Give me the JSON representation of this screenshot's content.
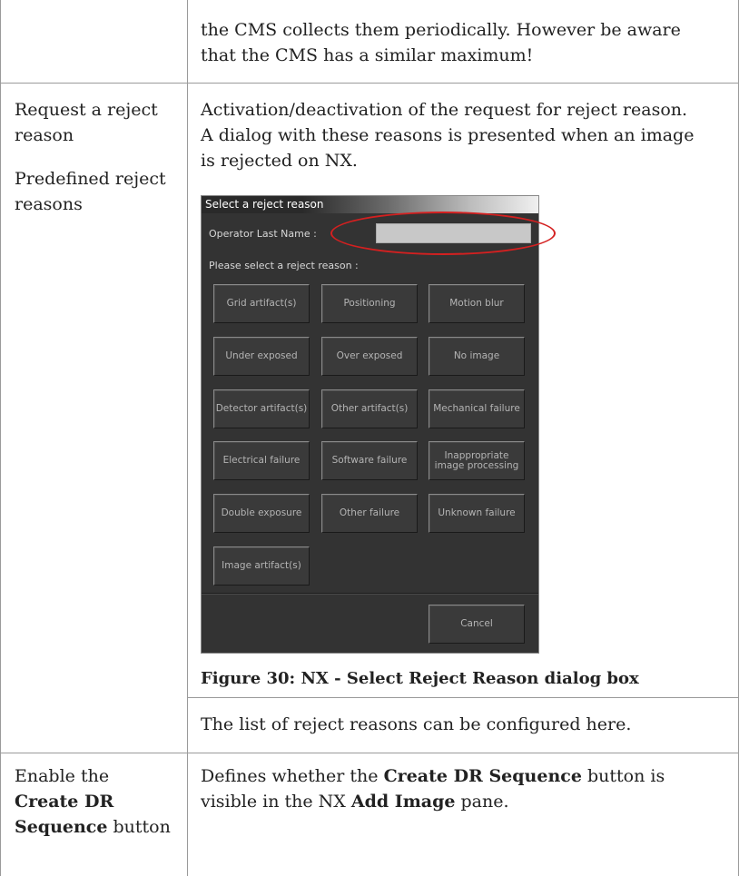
{
  "row0": {
    "description_line1": "the CMS collects them periodically. However be aware",
    "description_line2": "that the CMS has a similar maximum!"
  },
  "row1": {
    "setting_line1": "Request a reject",
    "setting_line2": "reason",
    "setting2_line1": "Predefined reject",
    "setting2_line2": "reasons",
    "description_line1": "Activation/deactivation of the request for reject reason.",
    "description_line2": "A dialog with these reasons is presented when an image",
    "description_line3": "is rejected on NX.",
    "figure_caption": "Figure 30: NX - Select Reject Reason dialog box",
    "note": "The list of reject reasons can be configured here."
  },
  "dialog": {
    "title": "Select a reject reason",
    "operator_label": "Operator Last Name :",
    "operator_value": "",
    "prompt": "Please select a reject reason :",
    "buttons": [
      "Grid artifact(s)",
      "Positioning",
      "Motion blur",
      "Under exposed",
      "Over exposed",
      "No image",
      "Detector artifact(s)",
      "Other artifact(s)",
      "Mechanical failure",
      "Electrical failure",
      "Software failure",
      "Inappropriate\nimage processing",
      "Double exposure",
      "Other failure",
      "Unknown failure",
      "Image artifact(s)"
    ],
    "cancel": "Cancel"
  },
  "row2": {
    "setting_line1": "Enable the",
    "setting_line2_bold": "Create DR",
    "setting_line3_bold": "Sequence",
    "setting_line3_rest": " button",
    "desc_prefix": "Defines whether the ",
    "desc_bold1": "Create DR Sequence",
    "desc_mid": " button is",
    "desc_line2_prefix": "visible in the NX ",
    "desc_bold2": "Add Image",
    "desc_line2_suffix": " pane."
  }
}
